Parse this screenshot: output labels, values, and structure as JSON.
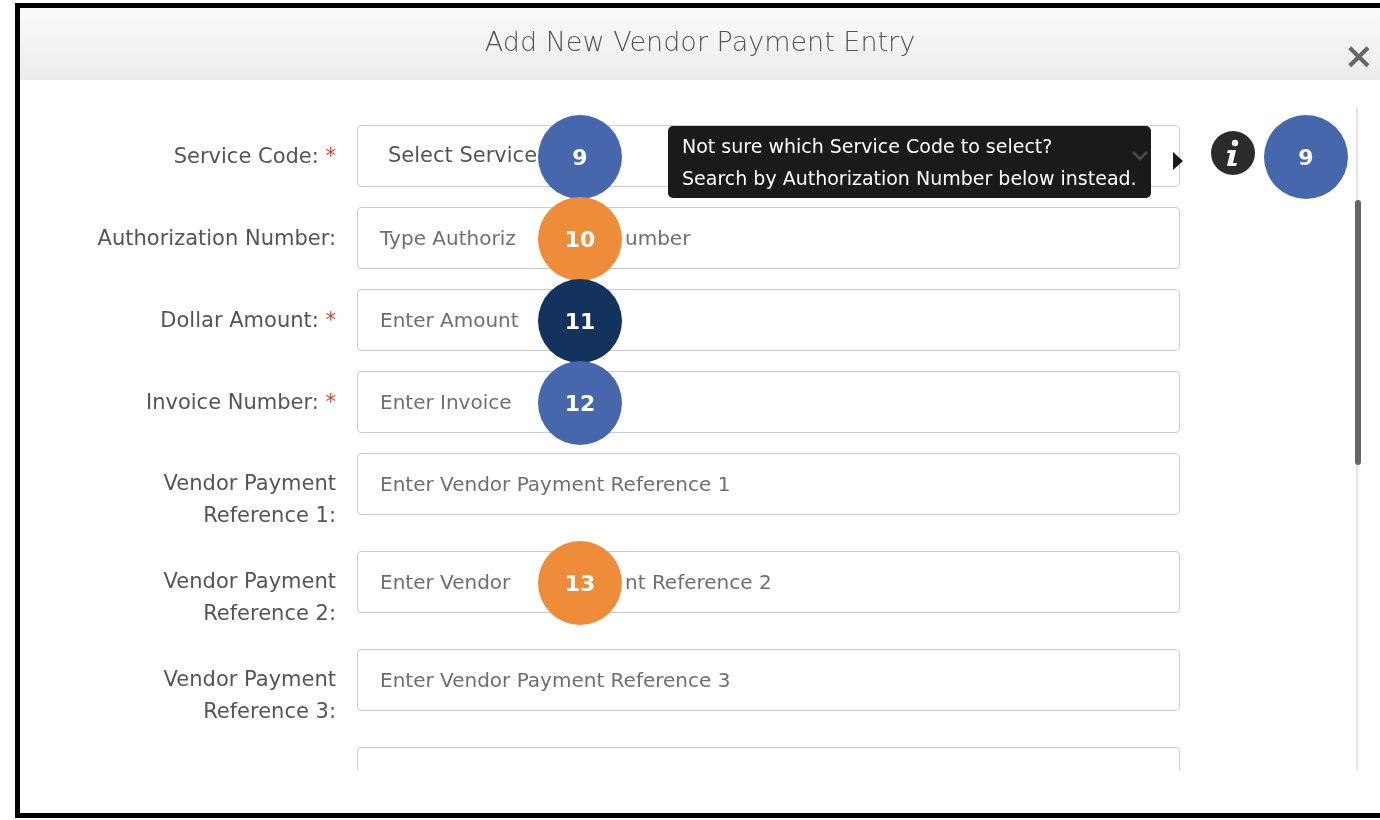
{
  "dialog": {
    "title": "Add New Vendor Payment Entry",
    "close": "×"
  },
  "fields": [
    {
      "kind": "select",
      "label_lines": [
        "Service Code:"
      ],
      "required": true,
      "placeholder_parts": [
        "Select Service"
      ],
      "badge": {
        "number": "9",
        "color": "#4767ad"
      }
    },
    {
      "kind": "input",
      "label_lines": [
        "Authorization Number:"
      ],
      "required": false,
      "placeholder_parts": [
        "Type Authoriz",
        "umber"
      ],
      "badge": {
        "number": "10",
        "color": "#ee8c3a"
      }
    },
    {
      "kind": "input",
      "label_lines": [
        "Dollar Amount:"
      ],
      "required": true,
      "placeholder_parts": [
        "Enter Amount"
      ],
      "badge": {
        "number": "11",
        "color": "#14325e"
      }
    },
    {
      "kind": "input",
      "label_lines": [
        "Invoice Number:"
      ],
      "required": true,
      "placeholder_parts": [
        "Enter Invoice"
      ],
      "badge": {
        "number": "12",
        "color": "#4767ad"
      }
    },
    {
      "kind": "input",
      "label_lines": [
        "Vendor Payment",
        "Reference 1:"
      ],
      "required": false,
      "placeholder_parts": [
        "Enter Vendor Payment Reference 1"
      ]
    },
    {
      "kind": "input",
      "label_lines": [
        "Vendor Payment",
        "Reference 2:"
      ],
      "required": false,
      "placeholder_parts": [
        "Enter Vendor",
        "nt Reference 2"
      ],
      "badge": {
        "number": "13",
        "color": "#ee8c3a"
      }
    },
    {
      "kind": "input",
      "label_lines": [
        "Vendor Payment",
        "Reference 3:"
      ],
      "required": false,
      "placeholder_parts": [
        "Enter Vendor Payment Reference 3"
      ]
    },
    {
      "kind": "partial"
    }
  ],
  "required_mark": "*",
  "tooltip": {
    "lines": [
      "Not sure which Service Code to select?",
      "Search by Authorization Number below instead."
    ]
  },
  "side_badge": {
    "number": "9",
    "color": "#4767ad"
  }
}
